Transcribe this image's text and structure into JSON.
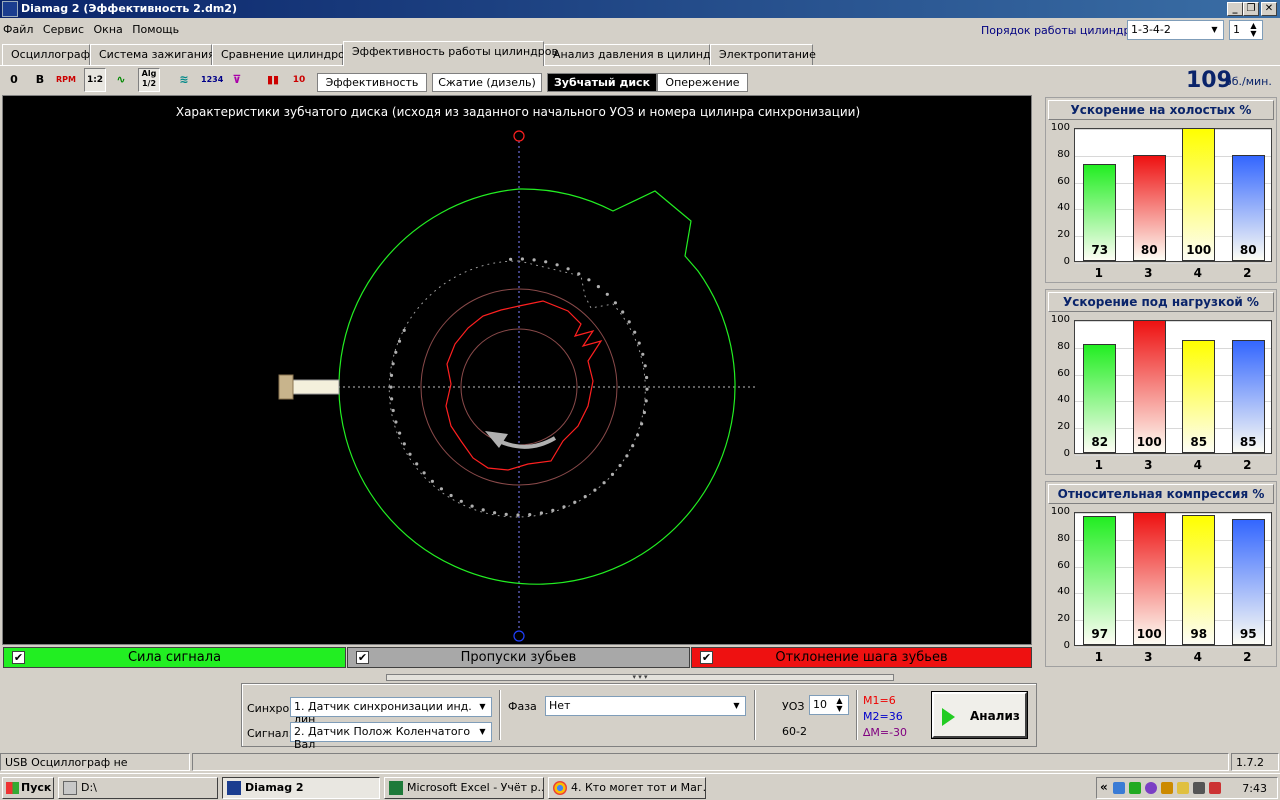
{
  "window": {
    "title": "Diamag 2 (Эффективность 2.dm2)",
    "min": "_",
    "restore": "❐",
    "close": "✕"
  },
  "menu": [
    "Файл",
    "Сервис",
    "Окна",
    "Помощь"
  ],
  "cylinder_order": {
    "label": "Порядок работы цилиндров",
    "value": "1-3-4-2",
    "spin_value": "1"
  },
  "tabs": [
    {
      "label": "Осциллограф"
    },
    {
      "label": "Система зажигания"
    },
    {
      "label": "Сравнение цилиндров"
    },
    {
      "label": "Эффективность работы цилиндров"
    },
    {
      "label": "Анализ давления в цилиндре"
    },
    {
      "label": "Электропитание"
    }
  ],
  "toolbar": {
    "t1": "0",
    "t2": "B",
    "t3": "RPM",
    "t4": "1:2",
    "t5": "",
    "t6": "Alg 1/2",
    "t7": "",
    "t8": "1234",
    "t9": "",
    "t10": "",
    "t11": "10"
  },
  "subtabs": [
    {
      "label": "Эффективность"
    },
    {
      "label": "Сжатие (дизель)"
    },
    {
      "label": "Зубчатый диск"
    },
    {
      "label": "Опережение"
    }
  ],
  "rpm": {
    "value": "109",
    "unit": "об./мин."
  },
  "canvas": {
    "title": "Характеристики зубчатого диска (исходя из заданного начального УОЗ и номера цилинра синхронизации)"
  },
  "legend": [
    {
      "label": "Сила сигнала",
      "check": "✔",
      "color": "#22ee22"
    },
    {
      "label": "Пропуски зубьев",
      "check": "✔",
      "color": "#a8a8a8"
    },
    {
      "label": "Отклонение шага зубьев",
      "check": "✔",
      "color": "#ee1111"
    }
  ],
  "bottom": {
    "sync_label": "Синхро:",
    "sync_value": "1.  Датчик синхронизации инд. лин",
    "signal_label": "Сигнал:",
    "signal_value": "2.  Датчик Полож Коленчатого Вал",
    "phase_label": "Фаза",
    "phase_value": "Нет",
    "uoz_label": "УОЗ",
    "uoz_value": "10",
    "teeth": "60-2",
    "m1": "M1=6",
    "m2": "M2=36",
    "dm": "∆M=-30",
    "analyze": "Анализ"
  },
  "charts": [
    {
      "title": "Ускорение на холостых %",
      "chart_data": {
        "type": "bar",
        "categories": [
          "1",
          "3",
          "4",
          "2"
        ],
        "values": [
          73,
          80,
          100,
          80
        ],
        "ylim": [
          0,
          100
        ],
        "yticks": [
          "100",
          "80",
          "60",
          "40",
          "20",
          "0"
        ]
      }
    },
    {
      "title": "Ускорение под нагрузкой %",
      "chart_data": {
        "type": "bar",
        "categories": [
          "1",
          "3",
          "4",
          "2"
        ],
        "values": [
          82,
          100,
          85,
          85
        ],
        "ylim": [
          0,
          100
        ],
        "yticks": [
          "100",
          "80",
          "60",
          "40",
          "20",
          "0"
        ]
      }
    },
    {
      "title": "Относительная компрессия %",
      "chart_data": {
        "type": "bar",
        "categories": [
          "1",
          "3",
          "4",
          "2"
        ],
        "values": [
          97,
          100,
          98,
          95
        ],
        "ylim": [
          0,
          100
        ],
        "yticks": [
          "100",
          "80",
          "60",
          "40",
          "20",
          "0"
        ]
      }
    }
  ],
  "bar_colors": [
    "#22ee22",
    "#ee1111",
    "#ffff00",
    "#3366ff"
  ],
  "status": {
    "left": "USB Осциллограф не подключен",
    "version": "1.7.2"
  },
  "taskbar": {
    "start": "Пуск",
    "tasks": [
      {
        "label": "D:\\"
      },
      {
        "label": "Diamag 2"
      },
      {
        "label": "Microsoft Excel - Учёт р..."
      },
      {
        "label": "4. Кто могет тот и Маг...."
      }
    ],
    "tray_arrow": "«",
    "clock": "7:43"
  }
}
